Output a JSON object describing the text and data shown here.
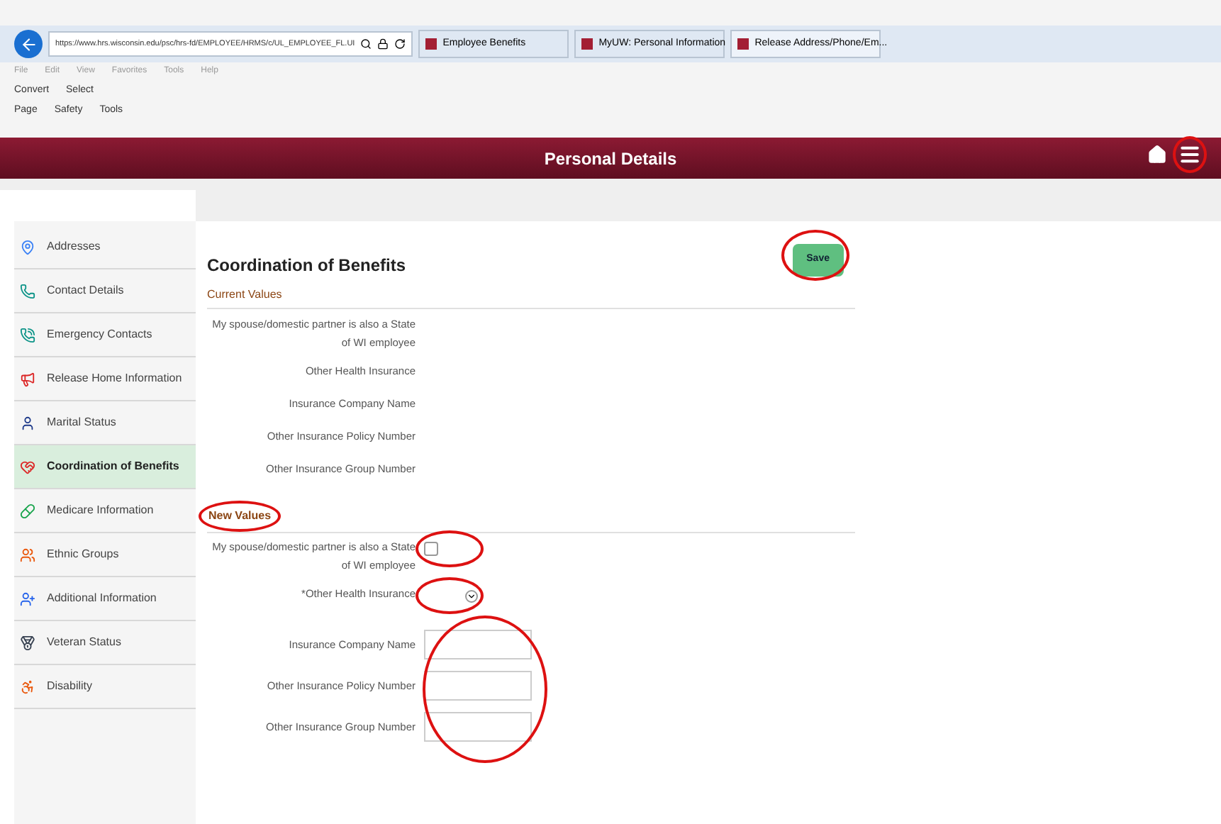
{
  "browser": {
    "address": "https://www.hrs.wisconsin.edu/psc/hrs-fd/EMPLOYEE/HRMS/c/UL_EMPLOYEE_FL.UI",
    "tabs": [
      {
        "label": "Employee Benefits",
        "selected": false
      },
      {
        "label": "MyUW: Personal Information",
        "selected": false
      },
      {
        "label": "Release Address/Phone/Em...",
        "selected": true
      }
    ],
    "menu": [
      "File",
      "Edit",
      "View",
      "Favorites",
      "Tools",
      "Help"
    ],
    "toolbar_1": [
      "Convert",
      "Select"
    ],
    "toolbar_2": [
      "Page",
      "Safety",
      "Tools"
    ]
  },
  "header": {
    "title": "Personal Details",
    "menu_circled": true
  },
  "sidebar": {
    "items": [
      {
        "label": "Addresses",
        "selected": false
      },
      {
        "label": "Contact Details",
        "selected": false
      },
      {
        "label": "Emergency Contacts",
        "selected": false
      },
      {
        "label": "Release Home Information",
        "selected": false
      },
      {
        "label": "Marital Status",
        "selected": false
      },
      {
        "label": "Coordination of Benefits",
        "selected": true
      },
      {
        "label": "Medicare Information",
        "selected": false
      },
      {
        "label": "Ethnic Groups",
        "selected": false
      },
      {
        "label": "Additional Information",
        "selected": false
      },
      {
        "label": "Veteran Status",
        "selected": false
      },
      {
        "label": "Disability",
        "selected": false
      }
    ]
  },
  "content": {
    "title": "Coordination of Benefits",
    "save_button": {
      "label": "Save",
      "circled": true
    },
    "current_values": {
      "heading": "Current Values",
      "fields": [
        "My spouse/domestic partner is also a State of WI employee",
        "Other Health Insurance",
        "Insurance Company Name",
        "Other Insurance Policy Number",
        "Other Insurance Group Number"
      ]
    },
    "new_values": {
      "heading": "New Values",
      "circled": true,
      "fields": [
        {
          "label": "My spouse/domestic partner is also a State of WI employee",
          "kind": "checkbox",
          "checked": false,
          "circled": true
        },
        {
          "label": "*Other Health Insurance",
          "kind": "select",
          "circled": true
        }
      ],
      "text_fields": {
        "circled": true,
        "labels": [
          "Insurance Company Name",
          "Other Insurance Policy Number",
          "Other Insurance Group Number"
        ]
      }
    }
  }
}
